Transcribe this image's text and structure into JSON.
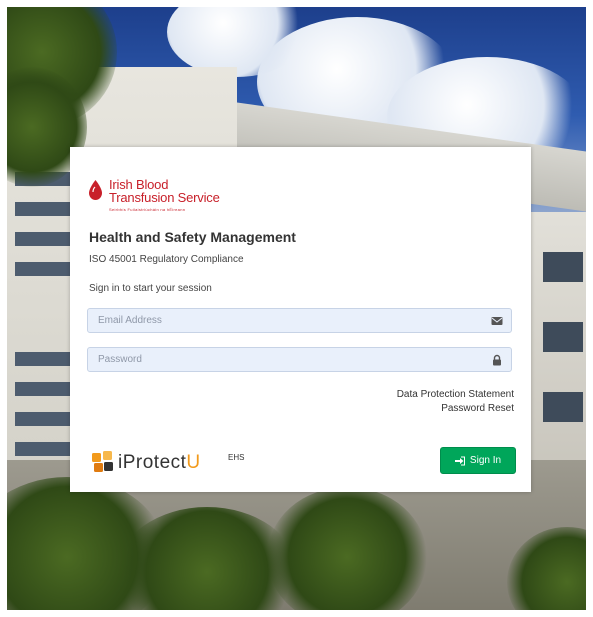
{
  "brand_logo": {
    "name_line1": "Irish Blood",
    "name_line2": "Transfusion Service",
    "tagline": "Seirbhís Fuilaistriúcháin na hÉireann"
  },
  "login": {
    "title": "Health and Safety Management",
    "subtitle": "ISO 45001 Regulatory Compliance",
    "session_text": "Sign in to start your session",
    "email_placeholder": "Email Address",
    "email_value": "",
    "password_placeholder": "Password",
    "password_value": "",
    "data_protection_link": "Data Protection Statement",
    "password_reset_link": "Password Reset",
    "signin_label": "Sign In"
  },
  "footer_brand": {
    "word_prefix": "iProtect",
    "word_suffix": "U",
    "suffix": "EHS"
  },
  "icons": {
    "email": "envelope-icon",
    "password": "lock-icon",
    "signin": "sign-in-icon"
  },
  "colors": {
    "accent_green": "#00a65a",
    "brand_red": "#c8202a",
    "brand_orange": "#f29a1b",
    "field_bg": "#e9f0fb"
  }
}
